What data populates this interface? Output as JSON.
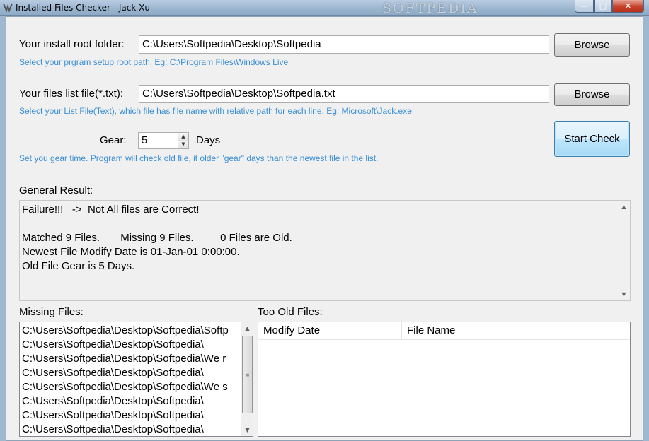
{
  "window": {
    "title": "Installed Files Checker - Jack Xu",
    "watermark": "SOFTPEDIA",
    "controls": {
      "minimize": "—",
      "maximize": "□",
      "close": "✕"
    }
  },
  "install_root": {
    "label": "Your install root folder:",
    "value": "C:\\Users\\Softpedia\\Desktop\\Softpedia",
    "hint": "Select your prgram setup root path. Eg: C:\\Program Files\\Windows Live",
    "browse_label": "Browse"
  },
  "files_list": {
    "label": "Your files list file(*.txt):",
    "value": "C:\\Users\\Softpedia\\Desktop\\Softpedia.txt",
    "hint": "Select your List File(Text), which file has file name with relative path for each line. Eg: Microsoft\\Jack.exe",
    "browse_label": "Browse"
  },
  "gear": {
    "label": "Gear:",
    "value": "5",
    "unit": "Days",
    "hint": "Set you gear time. Program will check old file, it older \"gear\" days than the newest file in the list.",
    "up_glyph": "▲",
    "down_glyph": "▼"
  },
  "start_check_label": "Start Check",
  "general_result": {
    "label": "General Result:",
    "lines": [
      "Failure!!!   ->  Not All files are Correct!",
      "",
      "Matched 9 Files.       Missing 9 Files.         0 Files are Old.",
      "Newest File Modify Date is 01-Jan-01 0:00:00.",
      "Old File Gear is 5 Days."
    ],
    "scroll_up": "▲",
    "scroll_down": "▼"
  },
  "missing_files": {
    "label": "Missing Files:",
    "items": [
      "C:\\Users\\Softpedia\\Desktop\\Softpedia\\Softp",
      "C:\\Users\\Softpedia\\Desktop\\Softpedia\\",
      "C:\\Users\\Softpedia\\Desktop\\Softpedia\\We r",
      "C:\\Users\\Softpedia\\Desktop\\Softpedia\\",
      "C:\\Users\\Softpedia\\Desktop\\Softpedia\\We s",
      "C:\\Users\\Softpedia\\Desktop\\Softpedia\\",
      "C:\\Users\\Softpedia\\Desktop\\Softpedia\\",
      "C:\\Users\\Softpedia\\Desktop\\Softpedia\\"
    ],
    "scroll_up": "▲",
    "scroll_down": "▼",
    "grip": "≡"
  },
  "too_old_files": {
    "label": "Too Old Files:",
    "columns": [
      "Modify Date",
      "File Name"
    ]
  }
}
